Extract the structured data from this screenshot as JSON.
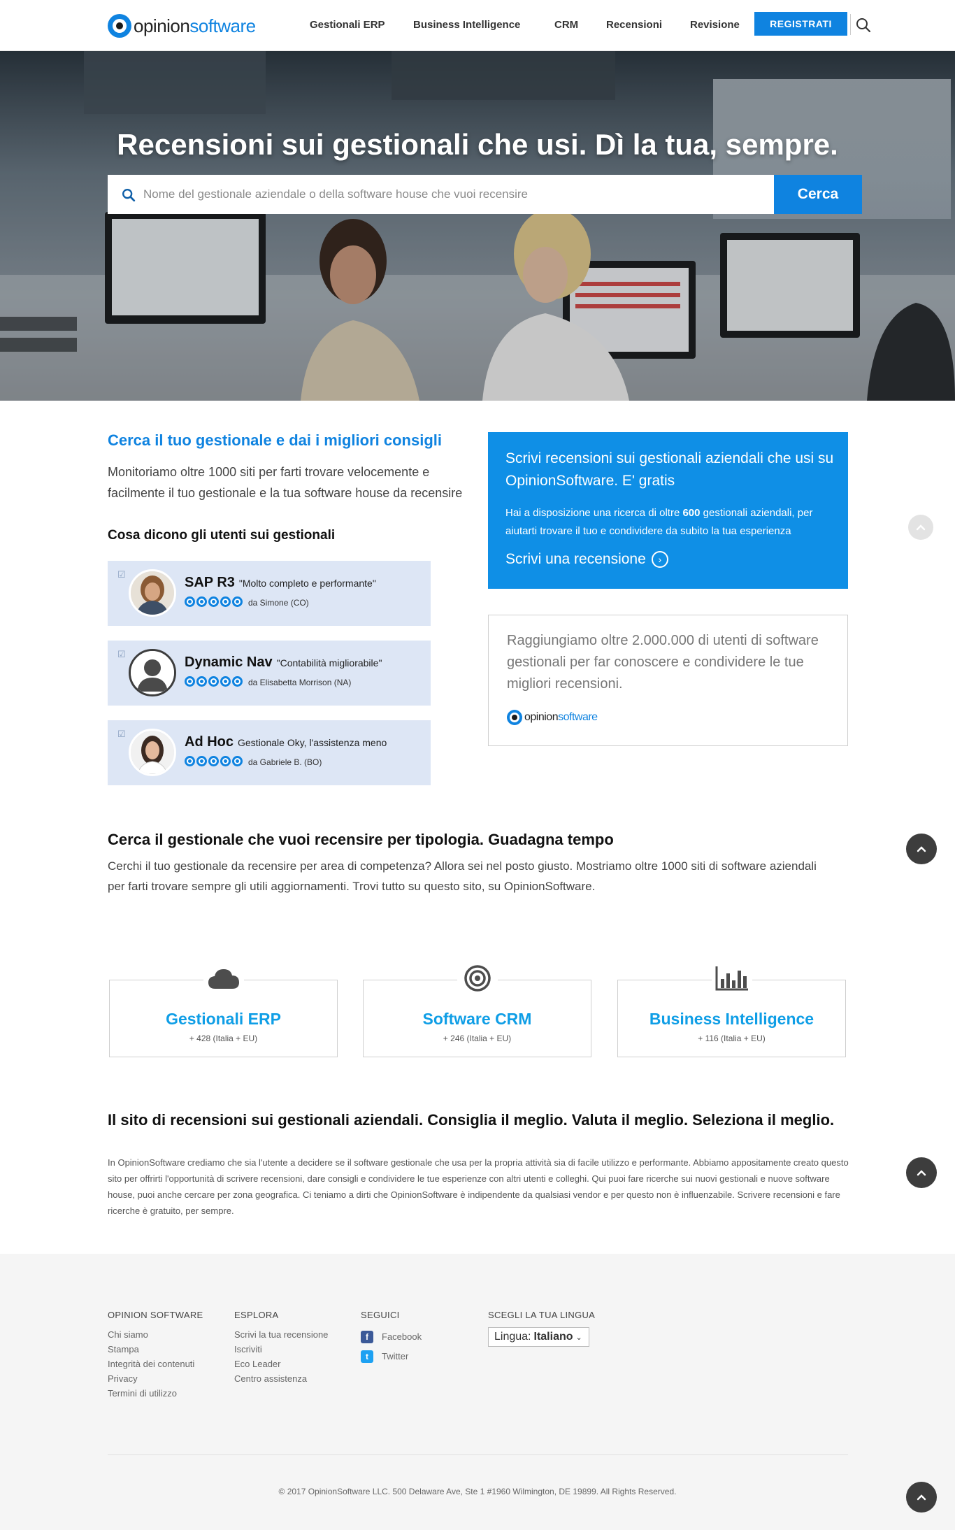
{
  "brand": {
    "name_part1": "opinion",
    "name_part2": "software",
    "color": "#0f83e0"
  },
  "nav": {
    "items": [
      "Gestionali ERP",
      "Business Intelligence",
      "CRM",
      "Recensioni",
      "Revisione"
    ],
    "register_label": "REGISTRATI",
    "search_icon": "search-icon"
  },
  "hero": {
    "title": "Recensioni sui gestionali che usi. Dì la tua, sempre.",
    "search_placeholder": "Nome del gestionale aziendale o della software house che vuoi recensire",
    "search_button": "Cerca"
  },
  "intro": {
    "heading": "Cerca il tuo gestionale e dai i migliori consigli",
    "text": "Monitoriamo oltre 1000 siti per farti trovare velocemente e facilmente il tuo gestionale e la tua software house da recensire"
  },
  "users": {
    "heading": "Cosa dicono gli utenti sui gestionali",
    "reviews": [
      {
        "product": "SAP R3",
        "quote": "\"Molto completo e performante\"",
        "author": "da Simone (CO)",
        "rating": 5
      },
      {
        "product": "Dynamic Nav",
        "quote": "\"Contabilità migliorabile\"",
        "author": "da Elisabetta Morrison (NA)",
        "rating": 5
      },
      {
        "product": "Ad Hoc",
        "quote": "Gestionale Oky, l'assistenza meno",
        "author": "da Gabriele B. (BO)",
        "rating": 5
      }
    ]
  },
  "cta": {
    "title": "Scrivi recensioni sui gestionali aziendali che usi su OpinionSoftware. E' gratis",
    "text_before": "Hai a disposizione una ricerca di oltre ",
    "text_bold": "600",
    "text_after": " gestionali aziendali, per aiutarti trovare il tuo e condividere da subito la tua esperienza",
    "link": "Scrivi una recensione"
  },
  "reach": {
    "text": "Raggiungiamo oltre 2.000.000 di utenti di software gestionali per far conoscere e condividere le tue migliori recensioni."
  },
  "typology": {
    "heading": "Cerca il gestionale che vuoi recensire per tipologia. Guadagna tempo",
    "text_line1": "Cerchi il tuo gestionale da recensire per area di competenza? Allora sei nel posto giusto. Mostriamo oltre 1000 siti di software aziendali",
    "text_line2": "per farti trovare sempre gli utili aggiornamenti. Trovi tutto su questo sito, su OpinionSoftware.",
    "categories": [
      {
        "title": "Gestionali ERP",
        "count": "+ 428 (Italia + EU)",
        "icon": "cloud-icon"
      },
      {
        "title": "Software CRM",
        "count": "+ 246 (Italia + EU)",
        "icon": "target-icon"
      },
      {
        "title": "Business Intelligence",
        "count": "+ 116 (Italia + EU)",
        "icon": "bar-chart-icon"
      }
    ]
  },
  "about": {
    "heading": "Il sito di recensioni sui gestionali aziendali. Consiglia il meglio. Valuta il meglio. Seleziona il meglio.",
    "text": "In OpinionSoftware crediamo che sia l'utente a decidere se il software gestionale che usa per la propria attività sia di facile utilizzo e performante. Abbiamo appositamente creato questo sito per offrirti l'opportunità di scrivere recensioni, dare consigli e condividere le tue esperienze con altri utenti e colleghi. Qui puoi fare ricerche sui nuovi gestionali e nuove software house, puoi anche cercare per zona geografica. Ci teniamo a dirti che OpinionSoftware è indipendente da qualsiasi vendor e per questo non è influenzabile. Scrivere recensioni e fare ricerche è gratuito, per sempre."
  },
  "footer": {
    "col1": {
      "heading": "OPINION SOFTWARE",
      "links": [
        "Chi siamo",
        "Stampa",
        "Integrità dei contenuti",
        "Privacy",
        "Termini di utilizzo"
      ]
    },
    "col2": {
      "heading": "ESPLORA",
      "links": [
        "Scrivi la tua recensione",
        "Iscriviti",
        "Eco Leader",
        "Centro assistenza"
      ]
    },
    "col3": {
      "heading": "SEGUICI",
      "links": [
        "Facebook",
        "Twitter"
      ]
    },
    "col4": {
      "heading": "SCEGLI LA TUA LINGUA",
      "lang_label": "Lingua:",
      "lang_value": "Italiano"
    },
    "copyright": "© 2017 OpinionSoftware LLC. 500 Delaware Ave, Ste 1 #1960 Wilmington, DE 19899. All Rights Reserved."
  }
}
